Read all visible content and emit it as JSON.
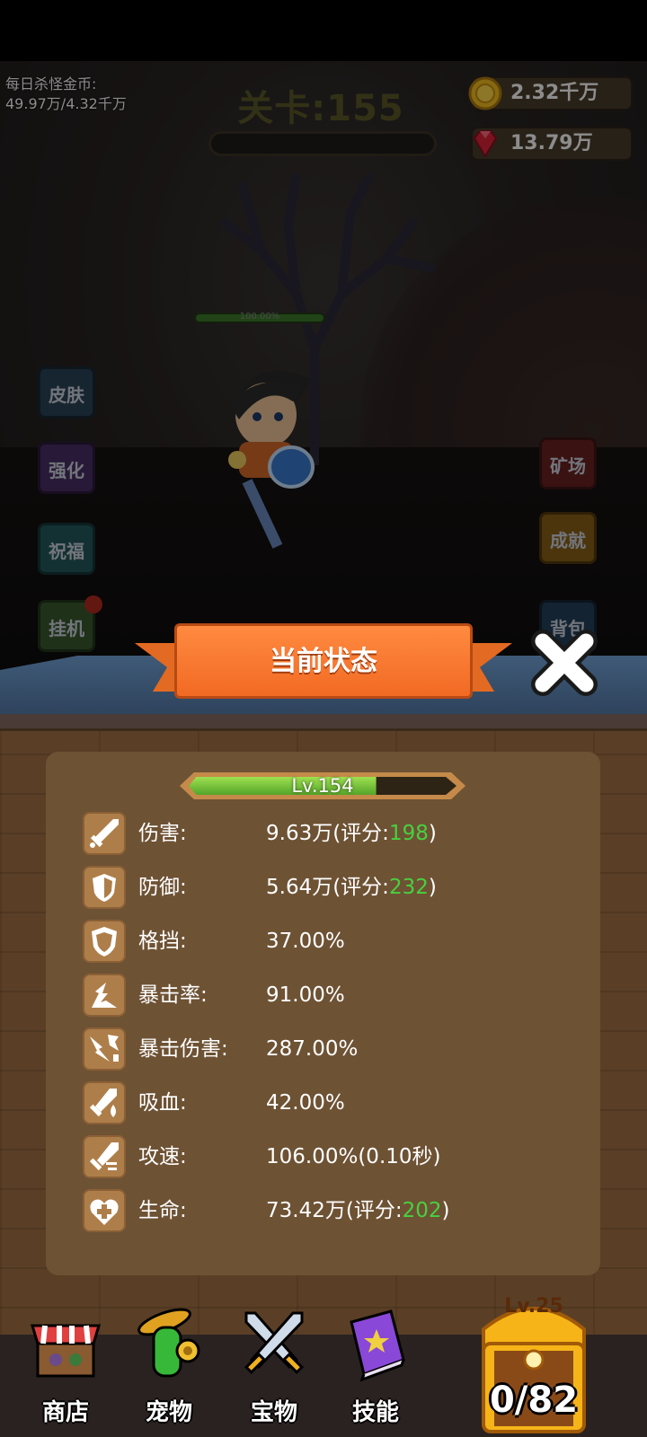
{
  "hud": {
    "daily_label": "每日杀怪金币:",
    "daily_value": "49.97万/4.32千万",
    "level_title": "关卡:155",
    "coins": "2.32千万",
    "gems": "13.79万",
    "hero_hp": "100.00%"
  },
  "side_buttons": {
    "skin": "皮肤",
    "forge": "强化",
    "bless": "祝福",
    "idle": "挂机",
    "mine": "矿场",
    "achievement": "成就",
    "bag": "背包"
  },
  "panel": {
    "title": "当前状态",
    "level_label": "Lv.154",
    "level_progress": 0.7,
    "stats": [
      {
        "icon": "sword-icon",
        "label": "伤害:",
        "value": "9.63万(评分:",
        "score": "198",
        "suffix": ")"
      },
      {
        "icon": "shield-icon",
        "label": "防御:",
        "value": "5.64万(评分:",
        "score": "232",
        "suffix": ")"
      },
      {
        "icon": "block-shield-icon",
        "label": "格挡:",
        "value": "37.00%"
      },
      {
        "icon": "crit-burst-icon",
        "label": "暴击率:",
        "value": "91.00%"
      },
      {
        "icon": "crit-damage-icon",
        "label": "暴击伤害:",
        "value": "287.00%"
      },
      {
        "icon": "lifesteal-icon",
        "label": "吸血:",
        "value": "42.00%"
      },
      {
        "icon": "attack-speed-icon",
        "label": "攻速:",
        "value": "106.00%(0.10秒)"
      },
      {
        "icon": "heart-plus-icon",
        "label": "生命:",
        "value": "73.42万(评分:",
        "score": "202",
        "suffix": ")"
      }
    ]
  },
  "nav": {
    "shop": "商店",
    "pet": "宠物",
    "treasure": "宝物",
    "skill": "技能",
    "chest_level": "Lv.25",
    "chest_count": "0/82"
  },
  "colors": {
    "accent_orange": "#f26a24",
    "score_green": "#48d040",
    "panel_brown": "#6e5234"
  }
}
